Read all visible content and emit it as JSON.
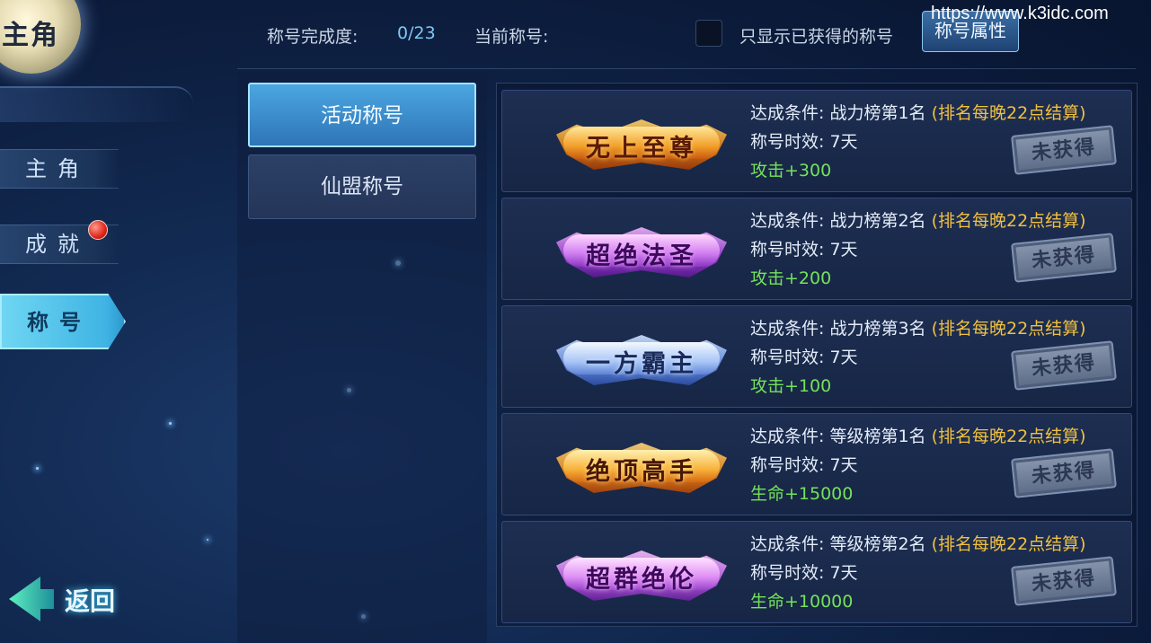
{
  "emblem": {
    "text": "主角"
  },
  "nav": {
    "items": [
      {
        "label": "主角",
        "active": false
      },
      {
        "label": "成就",
        "active": false,
        "has_notification": true
      },
      {
        "label": "称号",
        "active": true
      }
    ]
  },
  "back": {
    "label": "返回"
  },
  "topbar": {
    "completion_label": "称号完成度:",
    "completion_value": "0/23",
    "current_title_label": "当前称号:",
    "current_title_value": "",
    "filter_label": "只显示已获得的称号",
    "filter_checked": false,
    "attr_button": "称号属性",
    "watermark": "https://www.k3idc.com"
  },
  "tabs": [
    {
      "label": "活动称号",
      "active": true
    },
    {
      "label": "仙盟称号",
      "active": false
    }
  ],
  "titles": [
    {
      "badge": "无上至尊",
      "theme": "gold",
      "cond_label": "达成条件:",
      "cond": "战力榜第1名",
      "note": "(排名每晚22点结算)",
      "dur_label": "称号时效:",
      "dur": "7天",
      "bonus": "攻击+300",
      "status": "未获得"
    },
    {
      "badge": "超绝法圣",
      "theme": "purple",
      "cond_label": "达成条件:",
      "cond": "战力榜第2名",
      "note": "(排名每晚22点结算)",
      "dur_label": "称号时效:",
      "dur": "7天",
      "bonus": "攻击+200",
      "status": "未获得"
    },
    {
      "badge": "一方霸主",
      "theme": "blue",
      "cond_label": "达成条件:",
      "cond": "战力榜第3名",
      "note": "(排名每晚22点结算)",
      "dur_label": "称号时效:",
      "dur": "7天",
      "bonus": "攻击+100",
      "status": "未获得"
    },
    {
      "badge": "绝顶高手",
      "theme": "orange",
      "cond_label": "达成条件:",
      "cond": "等级榜第1名",
      "note": "(排名每晚22点结算)",
      "dur_label": "称号时效:",
      "dur": "7天",
      "bonus": "生命+15000",
      "status": "未获得"
    },
    {
      "badge": "超群绝伦",
      "theme": "violet",
      "cond_label": "达成条件:",
      "cond": "等级榜第2名",
      "note": "(排名每晚22点结算)",
      "dur_label": "称号时效:",
      "dur": "7天",
      "bonus": "生命+10000",
      "status": "未获得"
    }
  ],
  "colors": {
    "accent": "#3fb4e4",
    "note": "#f0c040",
    "bonus": "#74e25a",
    "gold": "#f5a623",
    "purple": "#b455e0",
    "blue": "#6f9cf0",
    "orange": "#f07b1e",
    "violet": "#c25fe8"
  }
}
